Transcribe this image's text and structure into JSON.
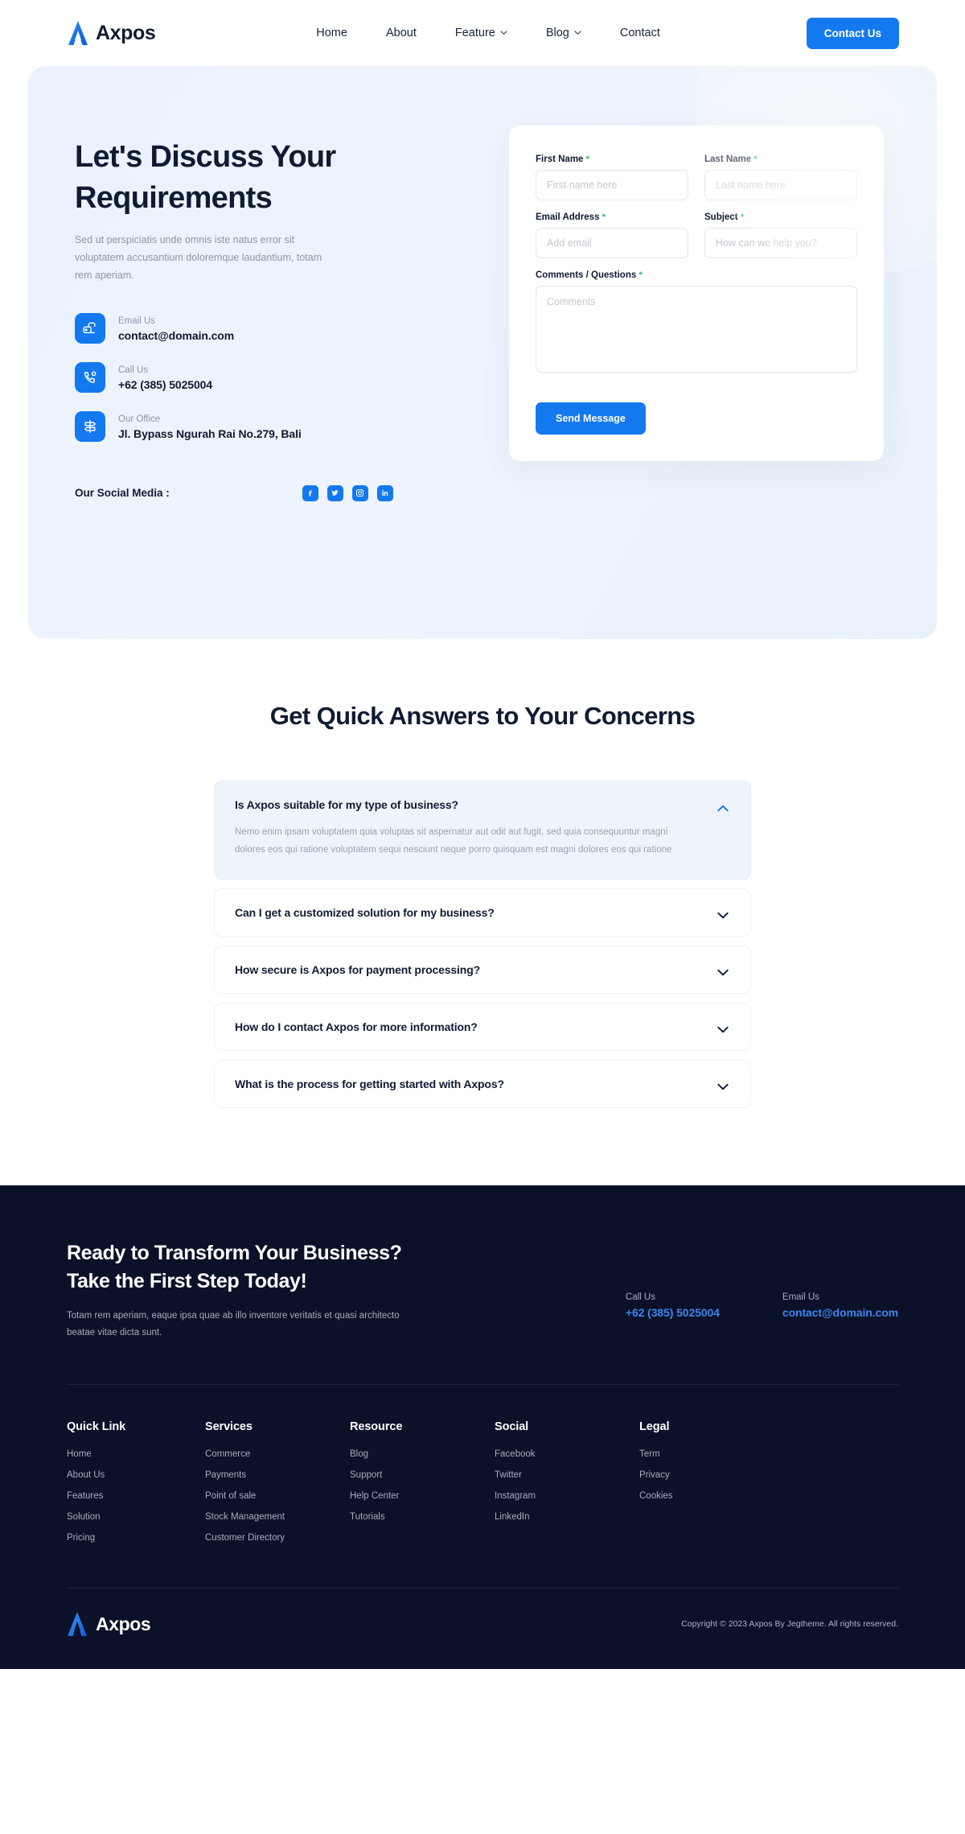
{
  "header": {
    "brand": "Axpos",
    "nav": [
      {
        "label": "Home",
        "caret": false
      },
      {
        "label": "About",
        "caret": false
      },
      {
        "label": "Feature",
        "caret": true
      },
      {
        "label": "Blog",
        "caret": true
      },
      {
        "label": "Contact",
        "caret": false
      }
    ],
    "cta_label": "Contact Us"
  },
  "hero": {
    "title": "Let's Discuss Your Requirements",
    "subtitle": "Sed ut perspiciatis unde omnis iste natus error sit voluptatem accusantium doloremque laudantium, totam rem aperiam.",
    "contacts": [
      {
        "icon": "mailbox-icon",
        "label": "Email Us",
        "value": "contact@domain.com"
      },
      {
        "icon": "phone-icon",
        "label": "Call Us",
        "value": "+62 (385) 5025004"
      },
      {
        "icon": "signpost-icon",
        "label": "Our Office",
        "value": "Jl. Bypass Ngurah Rai No.279, Bali"
      }
    ],
    "social_label": "Our Social Media :",
    "social": [
      {
        "name": "facebook-icon"
      },
      {
        "name": "twitter-icon"
      },
      {
        "name": "instagram-icon"
      },
      {
        "name": "linkedin-icon"
      }
    ]
  },
  "form": {
    "fields": {
      "first_name": {
        "label": "First Name",
        "required": "*",
        "placeholder": "First name here",
        "value": ""
      },
      "last_name": {
        "label": "Last Name",
        "required": "*",
        "placeholder": "Last name here",
        "value": ""
      },
      "email": {
        "label": "Email Address",
        "required": "*",
        "placeholder": "Add email",
        "value": ""
      },
      "subject": {
        "label": "Subject",
        "required": "*",
        "placeholder": "How can we help you?",
        "value": ""
      },
      "comments": {
        "label": "Comments / Questions",
        "required": "*",
        "placeholder": "Comments",
        "value": ""
      }
    },
    "submit_label": "Send Message"
  },
  "faq": {
    "title": "Get Quick Answers to Your Concerns",
    "items": [
      {
        "question": "Is Axpos suitable for my type of business?",
        "answer": "Nemo enim ipsam voluptatem quia voluptas sit aspernatur aut odit aut fugit, sed quia consequuntur magni dolores eos qui ratione voluptatem sequi nesciunt neque porro quisquam est magni dolores eos qui ratione",
        "open": true
      },
      {
        "question": "Can I get a customized solution for my business?",
        "answer": "",
        "open": false
      },
      {
        "question": "How secure is Axpos for payment processing?",
        "answer": "",
        "open": false
      },
      {
        "question": "How do I contact Axpos for more information?",
        "answer": "",
        "open": false
      },
      {
        "question": "What is the process for getting started with Axpos?",
        "answer": "",
        "open": false
      }
    ]
  },
  "footer": {
    "cta_title_line1": "Ready to Transform Your Business?",
    "cta_title_line2": "Take the First Step Today!",
    "cta_subtitle": "Totam rem aperiam, eaque ipsa quae ab illo inventore veritatis et quasi architecto beatae vitae dicta sunt.",
    "call_label": "Call Us",
    "call_value": "+62 (385) 5025004",
    "email_label": "Email Us",
    "email_value": "contact@domain.com",
    "columns": [
      {
        "title": "Quick Link",
        "links": [
          "Home",
          "About Us",
          "Features",
          "Solution",
          "Pricing"
        ]
      },
      {
        "title": "Services",
        "links": [
          "Commerce",
          "Payments",
          "Point of sale",
          "Stock Management",
          "Customer Directory"
        ]
      },
      {
        "title": "Resource",
        "links": [
          "Blog",
          "Support",
          "Help Center",
          "Tutorials"
        ]
      },
      {
        "title": "Social",
        "links": [
          "Facebook",
          "Twitter",
          "Instagram",
          "LinkedIn"
        ]
      },
      {
        "title": "Legal",
        "links": [
          "Term",
          "Privacy",
          "Cookies"
        ]
      }
    ],
    "brand": "Axpos",
    "copyright": "Copyright © 2023 Axpos By Jegtheme. All rights reserved."
  },
  "colors": {
    "accent": "#1479ef",
    "dark": "#0b1128",
    "heading": "#101b33",
    "muted": "#8d96a8",
    "required": "#1ec46a",
    "footer_link": "#3c86ef"
  }
}
